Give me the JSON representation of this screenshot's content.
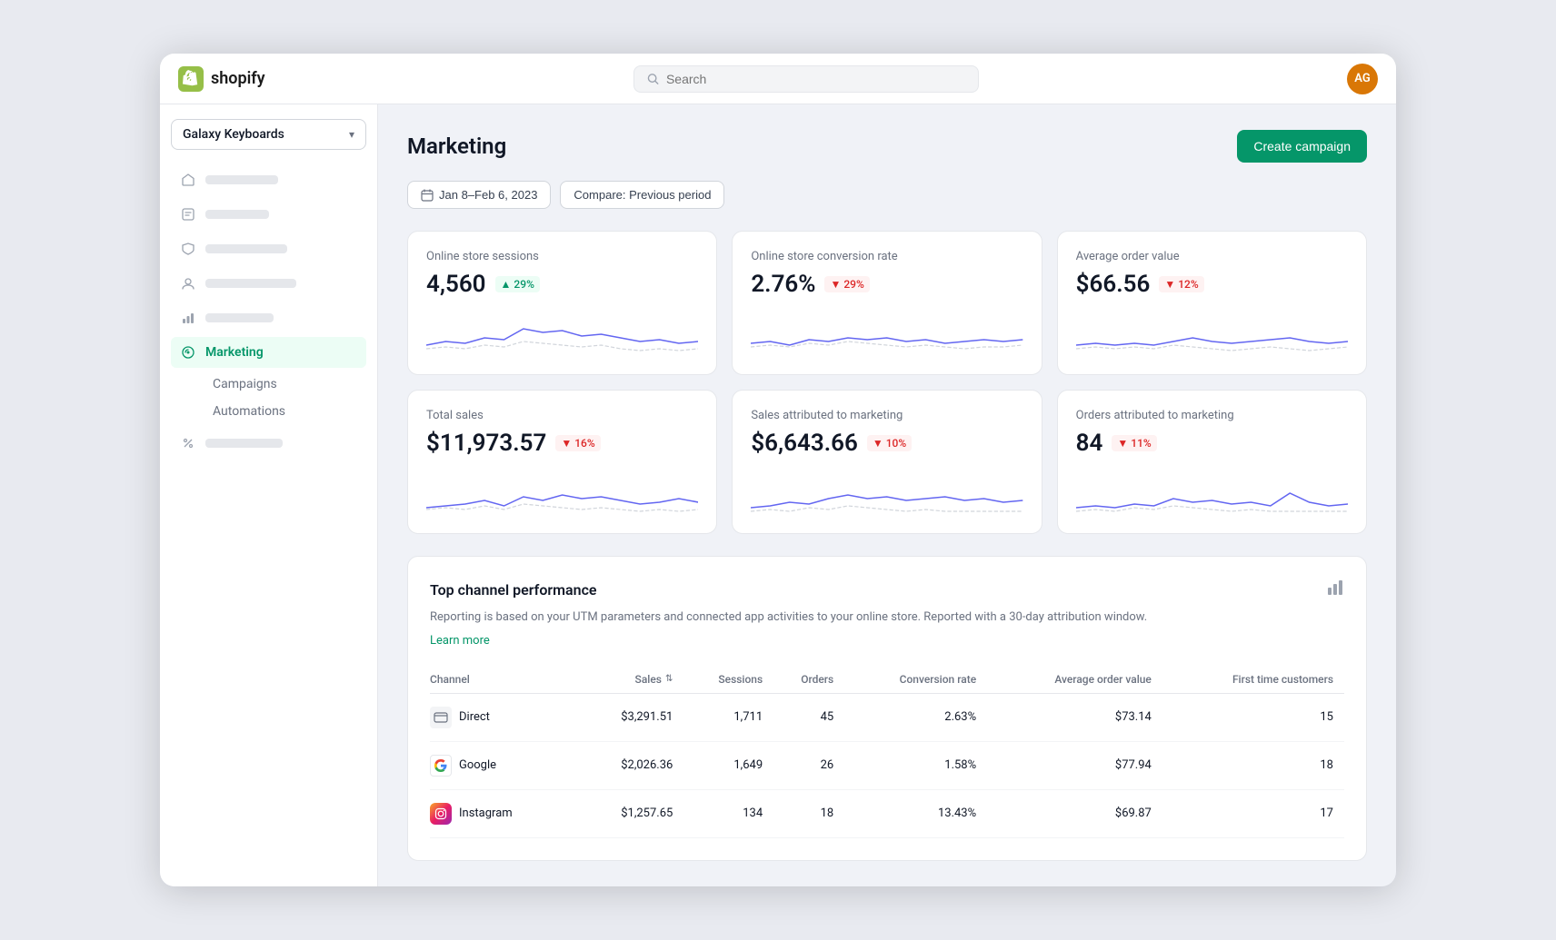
{
  "topbar": {
    "logo_text": "shopify",
    "search_placeholder": "Search",
    "avatar_initials": "AG"
  },
  "sidebar": {
    "store_name": "Galaxy Keyboards",
    "active_item": "Marketing",
    "sub_items": [
      "Campaigns",
      "Automations"
    ]
  },
  "page": {
    "title": "Marketing",
    "create_campaign_btn": "Create campaign",
    "date_filter": "Jan 8–Feb 6, 2023",
    "compare_filter": "Compare: Previous period"
  },
  "metrics": [
    {
      "label": "Online store sessions",
      "value": "4,560",
      "badge_value": "29%",
      "badge_direction": "up",
      "sparkline_type": "sessions"
    },
    {
      "label": "Online store conversion rate",
      "value": "2.76%",
      "badge_value": "29%",
      "badge_direction": "down",
      "sparkline_type": "conversion"
    },
    {
      "label": "Average order value",
      "value": "$66.56",
      "badge_value": "12%",
      "badge_direction": "down",
      "sparkline_type": "aov"
    },
    {
      "label": "Total sales",
      "value": "$11,973.57",
      "badge_value": "16%",
      "badge_direction": "down",
      "sparkline_type": "total_sales"
    },
    {
      "label": "Sales attributed to marketing",
      "value": "$6,643.66",
      "badge_value": "10%",
      "badge_direction": "down",
      "sparkline_type": "attributed_sales"
    },
    {
      "label": "Orders attributed to marketing",
      "value": "84",
      "badge_value": "11%",
      "badge_direction": "down",
      "sparkline_type": "attributed_orders"
    }
  ],
  "channel_section": {
    "title": "Top channel performance",
    "description": "Reporting is based on your UTM parameters and connected app activities to your online store. Reported with a 30-day attribution window.",
    "learn_more": "Learn more",
    "columns": [
      "Channel",
      "Sales",
      "Sessions",
      "Orders",
      "Conversion rate",
      "Average order value",
      "First time customers"
    ],
    "rows": [
      {
        "channel": "Direct",
        "icon_type": "direct",
        "sales": "$3,291.51",
        "sessions": "1,711",
        "orders": "45",
        "conversion_rate": "2.63%",
        "avg_order_value": "$73.14",
        "first_time_customers": "15"
      },
      {
        "channel": "Google",
        "icon_type": "google",
        "sales": "$2,026.36",
        "sessions": "1,649",
        "orders": "26",
        "conversion_rate": "1.58%",
        "avg_order_value": "$77.94",
        "first_time_customers": "18"
      },
      {
        "channel": "Instagram",
        "icon_type": "instagram",
        "sales": "$1,257.65",
        "sessions": "134",
        "orders": "18",
        "conversion_rate": "13.43%",
        "avg_order_value": "$69.87",
        "first_time_customers": "17"
      }
    ]
  }
}
